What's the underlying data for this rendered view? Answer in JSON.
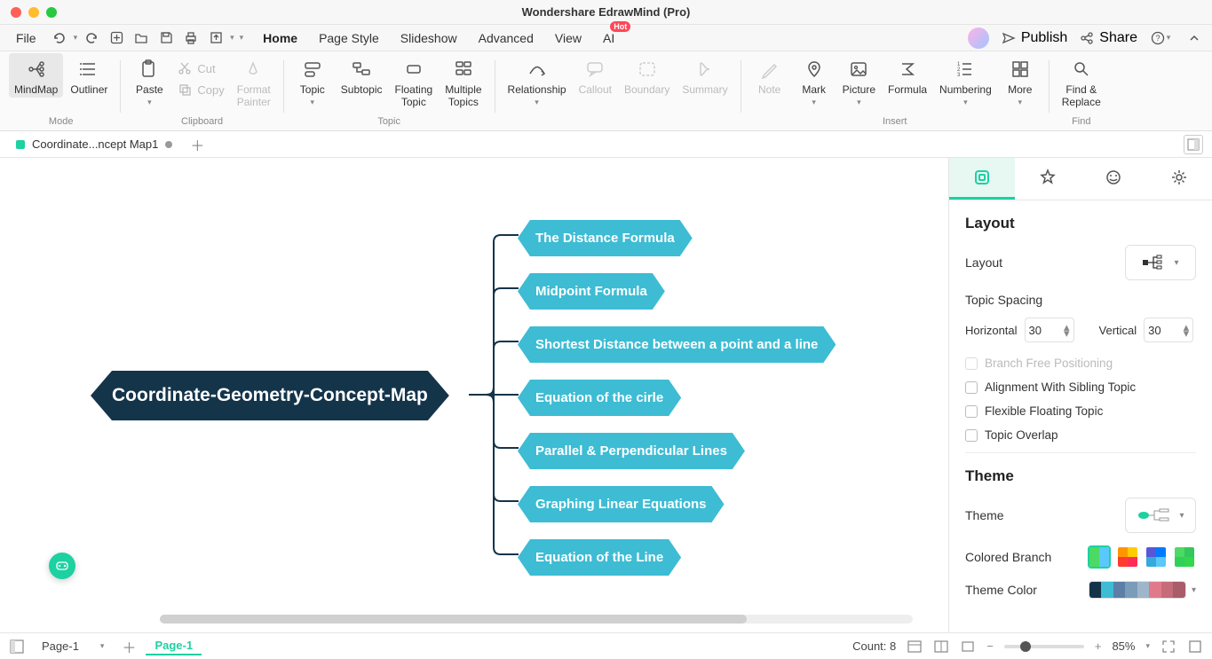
{
  "window": {
    "title": "Wondershare EdrawMind (Pro)"
  },
  "menubar": {
    "file": "File",
    "tabs": [
      "Home",
      "Page Style",
      "Slideshow",
      "Advanced",
      "View",
      "AI"
    ],
    "active_tab": "Home",
    "ai_badge": "Hot",
    "publish": "Publish",
    "share": "Share"
  },
  "ribbon": {
    "mode_group": "Mode",
    "clipboard_group": "Clipboard",
    "topic_group": "Topic",
    "insert_group": "Insert",
    "find_group": "Find",
    "mindmap": "MindMap",
    "outliner": "Outliner",
    "paste": "Paste",
    "cut": "Cut",
    "copy": "Copy",
    "format_painter": "Format\nPainter",
    "topic": "Topic",
    "subtopic": "Subtopic",
    "floating_topic": "Floating\nTopic",
    "multiple_topics": "Multiple\nTopics",
    "relationship": "Relationship",
    "callout": "Callout",
    "boundary": "Boundary",
    "summary": "Summary",
    "note": "Note",
    "mark": "Mark",
    "picture": "Picture",
    "formula": "Formula",
    "numbering": "Numbering",
    "more": "More",
    "find_replace": "Find &\nReplace"
  },
  "document": {
    "tab_name": "Coordinate...ncept Map1",
    "central": "Coordinate-Geometry-Concept-Map",
    "children": [
      "The Distance Formula",
      "Midpoint Formula",
      "Shortest Distance between a point and a line",
      "Equation of the cirle",
      "Parallel & Perpendicular Lines",
      "Graphing Linear Equations",
      "Equation of the Line"
    ]
  },
  "side": {
    "layout_heading": "Layout",
    "layout_label": "Layout",
    "topic_spacing": "Topic Spacing",
    "horizontal": "Horizontal",
    "vertical": "Vertical",
    "h_val": "30",
    "v_val": "30",
    "branch_free": "Branch Free Positioning",
    "align_sibling": "Alignment With Sibling Topic",
    "flex_float": "Flexible Floating Topic",
    "topic_overlap": "Topic Overlap",
    "theme_heading": "Theme",
    "theme_label": "Theme",
    "colored_branch": "Colored Branch",
    "theme_color": "Theme Color"
  },
  "status": {
    "page_dd": "Page-1",
    "page_tab": "Page-1",
    "count": "Count: 8",
    "zoom": "85%"
  }
}
